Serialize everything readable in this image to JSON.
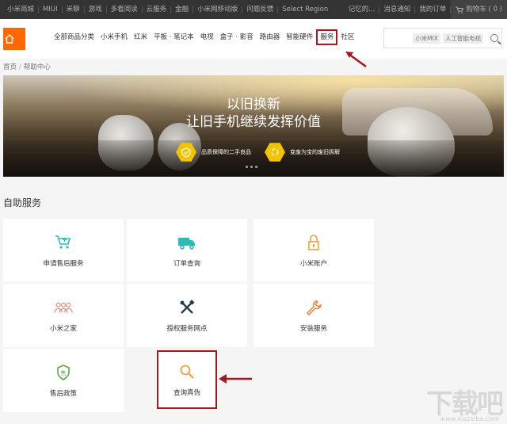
{
  "topbar": {
    "left": [
      "小米商城",
      "MIUI",
      "米聊",
      "游戏",
      "多看阅读",
      "云服务",
      "金融",
      "小米网移动版",
      "问题反馈",
      "Select Region"
    ],
    "right": [
      "记忆的...",
      "消息通知",
      "我的订单"
    ],
    "cart": "购物车 ( 0 )"
  },
  "logo": {
    "text": "mi"
  },
  "nav": {
    "items": [
      "全部商品分类",
      "小米手机",
      "红米",
      "平板 · 笔记本",
      "电视",
      "盒子 · 影音",
      "路由器",
      "智能硬件",
      "服务",
      "社区"
    ]
  },
  "search": {
    "tags": [
      "小米MIX",
      "人工智能电视"
    ]
  },
  "breadcrumb": {
    "home": "首页",
    "sep": "/",
    "current": "帮助中心"
  },
  "hero": {
    "line1": "以旧换新",
    "line2": "让旧手机继续发挥价值",
    "badge1": "品质保障的二手良品",
    "badge2": "变废为宝的废旧拆解"
  },
  "section": {
    "title": "自助服务"
  },
  "services": [
    {
      "label": "申请售后服务",
      "icon": "cart-icon"
    },
    {
      "label": "订单查询",
      "icon": "truck-icon"
    },
    {
      "label": "小米账户",
      "icon": "lock-icon"
    },
    {
      "label": "小米之家",
      "icon": "people-icon"
    },
    {
      "label": "授权服务网点",
      "icon": "tools-icon"
    },
    {
      "label": "安装服务",
      "icon": "wrench-icon"
    },
    {
      "label": "售后政策",
      "icon": "shield-icon"
    },
    {
      "label": "查询真伪",
      "icon": "search-icon"
    }
  ],
  "colors": {
    "accent": "#ff6700",
    "highlight": "#a3191f",
    "teal": "#2dbcb4",
    "yellow": "#f2c300"
  },
  "watermark": {
    "text": "下载吧",
    "url": "www.xiazaiba.com"
  }
}
